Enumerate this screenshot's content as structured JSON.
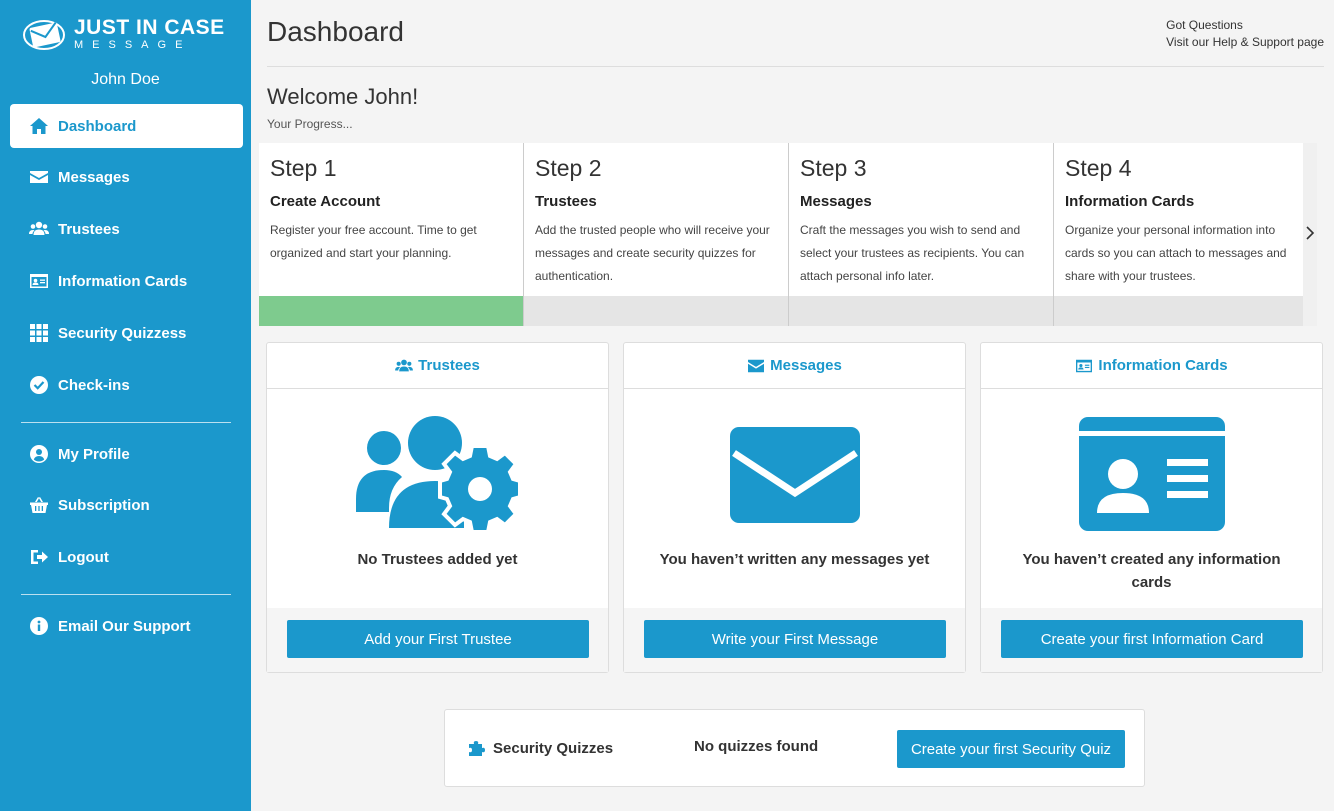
{
  "brand": {
    "line1": "JUST IN CASE",
    "line2": "MESSAGE"
  },
  "user": {
    "name": "John Doe"
  },
  "sidebar": {
    "items": [
      {
        "label": "Dashboard",
        "icon": "home-icon"
      },
      {
        "label": "Messages",
        "icon": "envelope-icon"
      },
      {
        "label": "Trustees",
        "icon": "users-icon"
      },
      {
        "label": "Information Cards",
        "icon": "id-card-icon"
      },
      {
        "label": "Security Quizzess",
        "icon": "grid-icon"
      },
      {
        "label": "Check-ins",
        "icon": "check-circle-icon"
      }
    ],
    "account_items": [
      {
        "label": "My Profile",
        "icon": "user-circle-icon"
      },
      {
        "label": "Subscription",
        "icon": "basket-icon"
      },
      {
        "label": "Logout",
        "icon": "sign-out-icon"
      }
    ],
    "support_item": {
      "label": "Email Our Support",
      "icon": "info-circle-icon"
    }
  },
  "header": {
    "title": "Dashboard",
    "help_line1": "Got Questions",
    "help_line2": "Visit our Help & Support page"
  },
  "welcome": {
    "title": "Welcome John!",
    "progress_label": "Your Progress..."
  },
  "steps": [
    {
      "step": "Step 1",
      "title": "Create Account",
      "desc": "Register your free account. Time to get organized and start your planning.",
      "complete": true
    },
    {
      "step": "Step 2",
      "title": "Trustees",
      "desc": "Add the trusted people who will receive your messages and create security quizzes for authentication.",
      "complete": false
    },
    {
      "step": "Step 3",
      "title": "Messages",
      "desc": "Craft the messages you wish to send and select your trustees as recipients. You can attach personal info later.",
      "complete": false
    },
    {
      "step": "Step 4",
      "title": "Information Cards",
      "desc": "Organize your personal information into cards so you can attach to messages and share with your trustees.",
      "complete": false
    }
  ],
  "cards": [
    {
      "title": "Trustees",
      "message": "No Trustees added yet",
      "button": "Add your First Trustee"
    },
    {
      "title": "Messages",
      "message": "You haven’t written any messages yet",
      "button": "Write your First Message"
    },
    {
      "title": "Information Cards",
      "message": "You haven’t created any information cards",
      "button": "Create your first Information Card"
    }
  ],
  "quiz": {
    "title": "Security Quizzes",
    "empty": "No quizzes found",
    "button": "Create your first Security Quiz"
  },
  "colors": {
    "brand": "#1b98cc",
    "progress_done": "#7ecb8e",
    "progress_pending": "#e5e5e5"
  }
}
